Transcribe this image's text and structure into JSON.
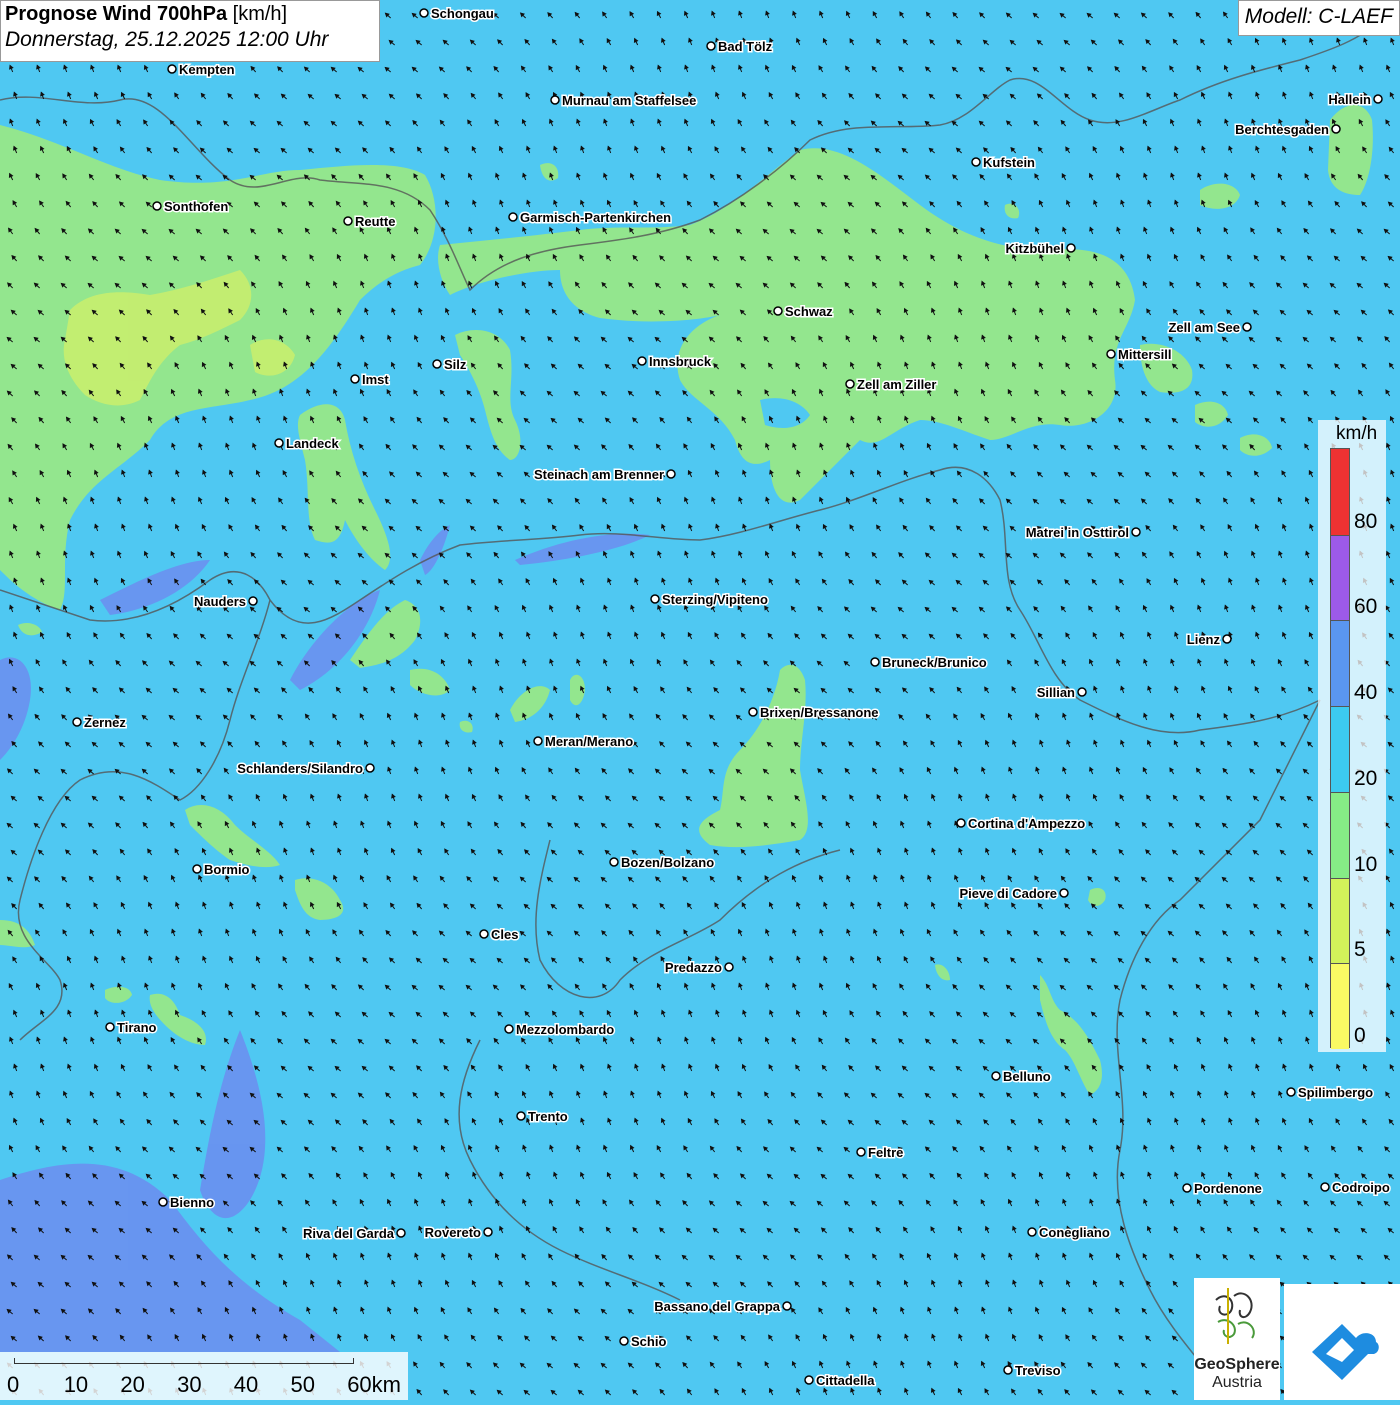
{
  "header": {
    "title_bold": "Prognose Wind 700hPa",
    "title_unit": "[km/h]",
    "datetime": "Donnerstag, 25.12.2025 12:00 Uhr"
  },
  "model_label": "Modell: C-LAEF",
  "legend": {
    "unit": "km/h",
    "labels": [
      "80",
      "60",
      "40",
      "20",
      "10",
      "5",
      "0"
    ],
    "colors": [
      "#ee3232",
      "#9c5ae8",
      "#5a96f0",
      "#3ccaf0",
      "#86ec86",
      "#d2f25a",
      "#fafa64"
    ]
  },
  "scale_bar": {
    "labels": [
      "0",
      "10",
      "20",
      "30",
      "40",
      "50",
      "60km"
    ]
  },
  "logo": {
    "name_line1": "GeoSphere",
    "name_line2": "Austria"
  },
  "colors": {
    "wind_20_40": "#4fc8f2",
    "wind_10_20": "#93e68e",
    "wind_5_10": "#c8ee6e",
    "wind_40_60": "#6c8df0"
  },
  "cities": [
    {
      "name": "Schongau"
    },
    {
      "name": "Bad Tölz"
    },
    {
      "name": "Kempten"
    },
    {
      "name": "Murnau am Staffelsee"
    },
    {
      "name": "Hallein"
    },
    {
      "name": "Berchtesgaden"
    },
    {
      "name": "Kufstein"
    },
    {
      "name": "Sonthofen"
    },
    {
      "name": "Reutte"
    },
    {
      "name": "Garmisch-Partenkirchen"
    },
    {
      "name": "Kitzbühel"
    },
    {
      "name": "Schwaz"
    },
    {
      "name": "Zell am See"
    },
    {
      "name": "Mittersill"
    },
    {
      "name": "Imst"
    },
    {
      "name": "Silz"
    },
    {
      "name": "Innsbruck"
    },
    {
      "name": "Zell am Ziller"
    },
    {
      "name": "Landeck"
    },
    {
      "name": "Steinach am Brenner"
    },
    {
      "name": "Matrei in Osttirol"
    },
    {
      "name": "Nauders"
    },
    {
      "name": "Sterzing/Vipiteno"
    },
    {
      "name": "Lienz"
    },
    {
      "name": "Bruneck/Brunico"
    },
    {
      "name": "Sillian"
    },
    {
      "name": "Zernez"
    },
    {
      "name": "Brixen/Bressanone"
    },
    {
      "name": "Meran/Merano"
    },
    {
      "name": "Schlanders/Silandro"
    },
    {
      "name": "Cortina d'Ampezzo"
    },
    {
      "name": "Bormio"
    },
    {
      "name": "Bozen/Bolzano"
    },
    {
      "name": "Pieve di Cadore"
    },
    {
      "name": "Cles"
    },
    {
      "name": "Predazzo"
    },
    {
      "name": "Tirano"
    },
    {
      "name": "Mezzolombardo"
    },
    {
      "name": "Belluno"
    },
    {
      "name": "Spilimbergo"
    },
    {
      "name": "Trento"
    },
    {
      "name": "Feltre"
    },
    {
      "name": "Pordenone"
    },
    {
      "name": "Codroipo"
    },
    {
      "name": "Bienno"
    },
    {
      "name": "Riva del Garda"
    },
    {
      "name": "Rovereto"
    },
    {
      "name": "Conegliano"
    },
    {
      "name": "Bassano del Grappa"
    },
    {
      "name": "Schio"
    },
    {
      "name": "Treviso"
    },
    {
      "name": "Cittadella"
    }
  ]
}
